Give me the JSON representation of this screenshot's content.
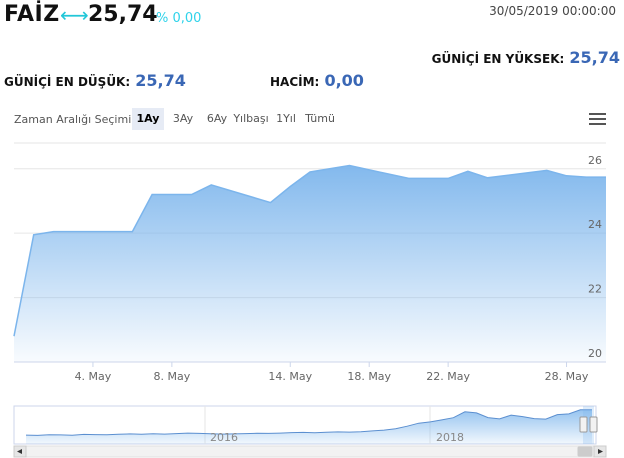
{
  "header": {
    "title": "FAİZ",
    "arrow": "⟷",
    "price": "25,74",
    "change": "% 0,00",
    "datetime": "30/05/2019 00:00:00"
  },
  "stats": {
    "high_label": "GÜNİÇİ EN YÜKSEK:",
    "high_value": "25,74",
    "low_label": "GÜNİÇİ EN DÜŞÜK:",
    "low_value": "25,74",
    "volume_label": "HACİM:",
    "volume_value": "0,00"
  },
  "range_selector": {
    "label": "Zaman Aralığı Seçimi",
    "buttons": [
      "1Ay",
      "3Ay",
      "6Ay",
      "Yılbaşı",
      "1Yıl",
      "Tümü"
    ],
    "active": "1Ay"
  },
  "icons": {
    "menu": "hamburger-menu-icon",
    "scroll_left": "chevron-left-icon",
    "scroll_right": "chevron-right-icon",
    "navigator_handle": "grip-icon"
  },
  "colors": {
    "line": "#7cb5ec",
    "fill_top": "#7cb5ec",
    "accent": "#3a67b5",
    "change": "#2fd3ea"
  },
  "chart_data": {
    "type": "area",
    "x": [
      "2019-04-30",
      "2019-05-01",
      "2019-05-02",
      "2019-05-03",
      "2019-05-06",
      "2019-05-07",
      "2019-05-08",
      "2019-05-09",
      "2019-05-10",
      "2019-05-13",
      "2019-05-14",
      "2019-05-15",
      "2019-05-16",
      "2019-05-17",
      "2019-05-20",
      "2019-05-21",
      "2019-05-22",
      "2019-05-23",
      "2019-05-24",
      "2019-05-27",
      "2019-05-28",
      "2019-05-29",
      "2019-05-30"
    ],
    "values": [
      20.8,
      23.95,
      24.05,
      24.05,
      24.05,
      25.2,
      25.2,
      25.2,
      25.5,
      24.95,
      25.45,
      25.9,
      26.0,
      26.1,
      25.7,
      25.7,
      25.7,
      25.92,
      25.72,
      25.95,
      25.78,
      25.74,
      25.74
    ],
    "x_ticks": [
      "4. May",
      "8. May",
      "14. May",
      "18. May",
      "22. May",
      "28. May"
    ],
    "y_ticks": [
      "20",
      "22",
      "24",
      "26"
    ],
    "ylim": [
      20,
      26.8
    ],
    "grid": true,
    "navigator": {
      "labels": [
        "2016",
        "2018"
      ],
      "values": [
        10.4,
        10.2,
        10.6,
        10.5,
        10.3,
        10.8,
        10.7,
        10.6,
        10.9,
        11.1,
        10.9,
        11.2,
        11.0,
        11.3,
        11.6,
        11.4,
        11.2,
        11.0,
        11.1,
        11.3,
        11.5,
        11.4,
        11.6,
        11.9,
        12.0,
        11.8,
        12.1,
        12.3,
        12.2,
        12.4,
        12.9,
        13.4,
        14.2,
        15.8,
        17.6,
        18.4,
        19.6,
        20.9,
        24.5,
        23.8,
        21.0,
        20.2,
        22.5,
        21.6,
        20.4,
        20.1,
        22.8,
        23.2,
        25.7,
        25.7
      ]
    }
  }
}
